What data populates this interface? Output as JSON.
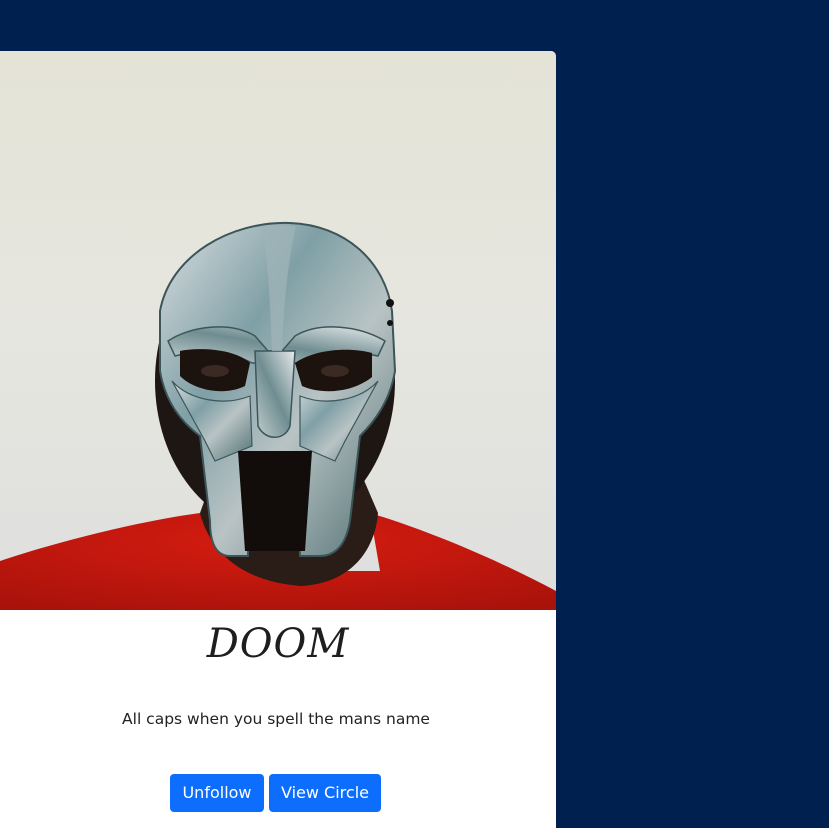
{
  "profile": {
    "name": "DOOM",
    "bio": "All caps when you spell the mans name",
    "photo_subject": "man-in-metal-mask"
  },
  "actions": {
    "unfollow_label": "Unfollow",
    "view_circle_label": "View Circle"
  },
  "colors": {
    "page_background": "#00214f",
    "card_background": "#ffffff",
    "button_primary": "#0d6efd",
    "shirt_red": "#c8180e"
  }
}
